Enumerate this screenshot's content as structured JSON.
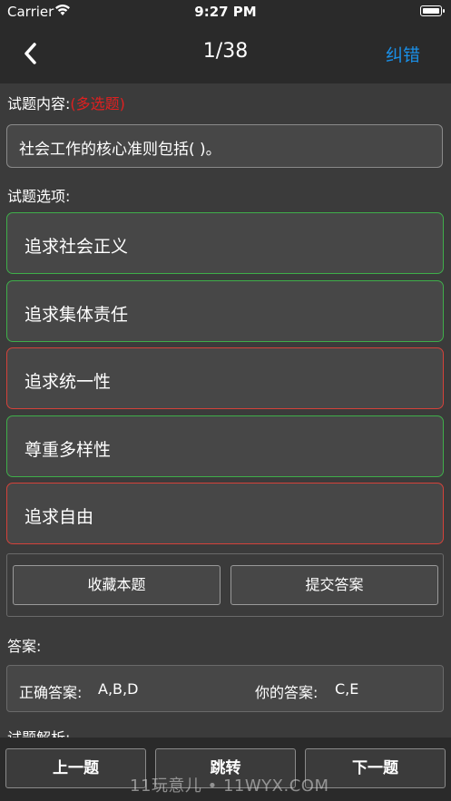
{
  "status_bar": {
    "carrier": "Carrier",
    "time": "9:27 PM"
  },
  "nav": {
    "title": "1/38",
    "correct_label": "纠错"
  },
  "question": {
    "content_label": "试题内容:",
    "type_label": "(多选题)",
    "text": "社会工作的核心准则包括(   )。"
  },
  "options_label": "试题选项:",
  "options": [
    {
      "text": "追求社会正义",
      "state": "correct",
      "color": "#3fae4a"
    },
    {
      "text": "追求集体责任",
      "state": "correct",
      "color": "#3fae4a"
    },
    {
      "text": "追求统一性",
      "state": "wrong",
      "color": "#d4423a"
    },
    {
      "text": "尊重多样性",
      "state": "correct",
      "color": "#3fae4a"
    },
    {
      "text": "追求自由",
      "state": "wrong",
      "color": "#d4423a"
    }
  ],
  "actions": {
    "favorite_label": "收藏本题",
    "submit_label": "提交答案"
  },
  "answer": {
    "label": "答案:",
    "correct_label": "正确答案:",
    "correct_value": "A,B,D",
    "yours_label": "你的答案:",
    "yours_value": "C,E"
  },
  "analysis_label": "试题解析:",
  "bottom": {
    "prev_label": "上一题",
    "jump_label": "跳转",
    "next_label": "下一题"
  },
  "watermark": "11玩意儿 • 11WYX.COM",
  "colors": {
    "accent": "#1a8fe6",
    "type_red": "#e02020",
    "correct_border": "#3fae4a",
    "wrong_border": "#d4423a"
  }
}
